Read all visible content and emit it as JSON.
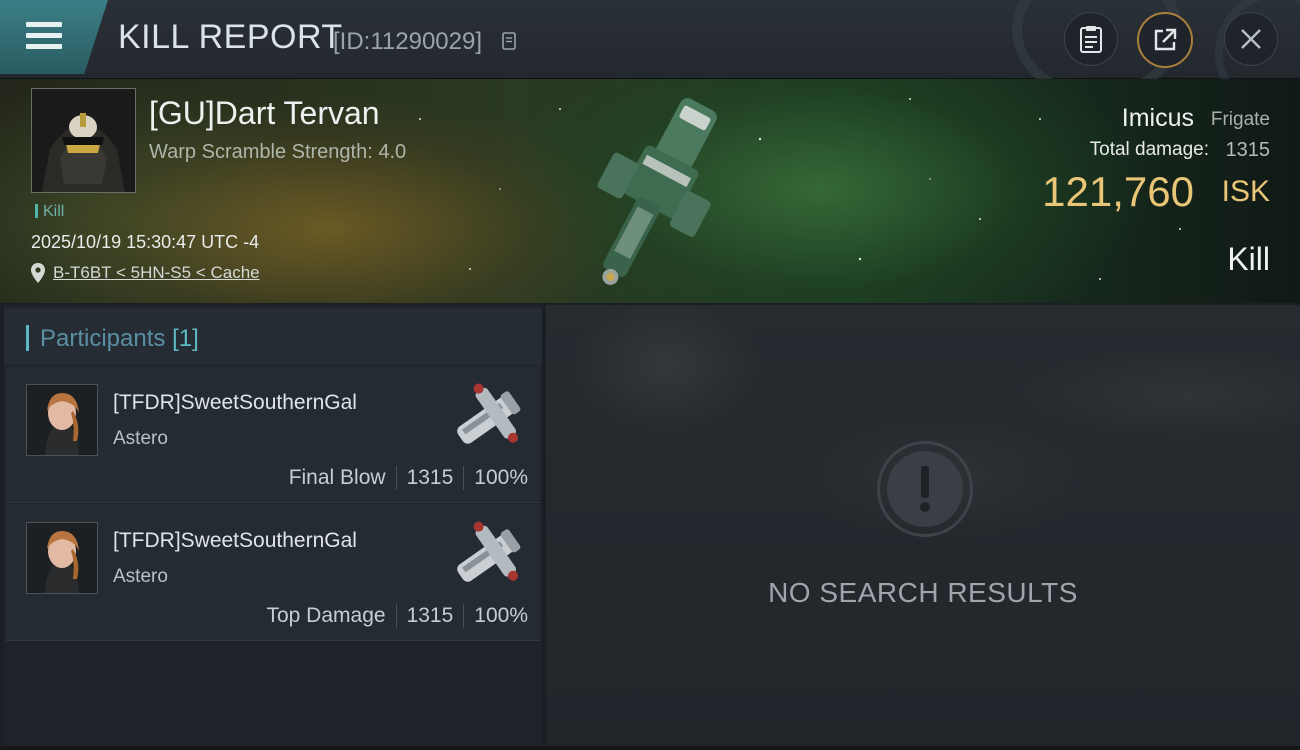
{
  "header": {
    "title": "KILL REPORT",
    "report_id": "[ID:11290029]",
    "icons": [
      "menu-icon",
      "copy-id-icon",
      "clipboard-icon",
      "share-icon",
      "close-icon"
    ]
  },
  "victim": {
    "name": "[GU]Dart Tervan",
    "warp_scramble": "Warp Scramble Strength: 4.0",
    "tag": "Kill",
    "datetime": "2025/10/19 15:30:47 UTC -4",
    "location": "B-T6BT < 5HN-S5 < Cache"
  },
  "ship": {
    "name": "Imicus",
    "class": "Frigate",
    "total_damage_label": "Total damage:",
    "total_damage": "1315",
    "isk_value": "121,760",
    "isk_unit": "ISK",
    "result": "Kill"
  },
  "participants": {
    "label": "Participants",
    "count": "[1]",
    "rows": [
      {
        "name": "[TFDR]SweetSouthernGal",
        "ship": "Astero",
        "role": "Final Blow",
        "damage": "1315",
        "percent": "100%"
      },
      {
        "name": "[TFDR]SweetSouthernGal",
        "ship": "Astero",
        "role": "Top Damage",
        "damage": "1315",
        "percent": "100%"
      }
    ]
  },
  "results": {
    "empty_text": "NO SEARCH RESULTS"
  },
  "colors": {
    "accent_teal": "#5eb9c4",
    "isk_gold": "#e9c677",
    "share_ring": "#a8803c"
  }
}
